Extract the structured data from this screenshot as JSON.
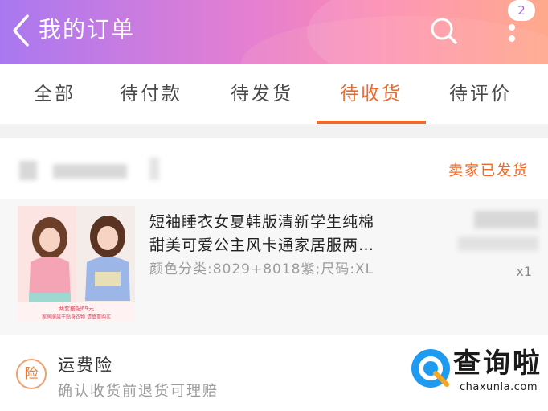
{
  "header": {
    "title": "我的订单",
    "badge_count": "2",
    "icons": [
      "back-chevron-icon",
      "search-icon",
      "more-vertical-icon"
    ]
  },
  "tabs": [
    {
      "label": "全部",
      "active": false
    },
    {
      "label": "待付款",
      "active": false
    },
    {
      "label": "待发货",
      "active": false
    },
    {
      "label": "待收货",
      "active": true
    },
    {
      "label": "待评价",
      "active": false
    }
  ],
  "order": {
    "status": "卖家已发货",
    "item": {
      "title_line1": "短袖睡衣女夏韩版清新学生纯棉",
      "title_line2": "甜美可爱公主风卡通家居服两…",
      "spec": "颜色分类:8029+8018紫;尺码:XL",
      "quantity": "x1",
      "thumb_caption_1": "两套搭配69元",
      "thumb_caption_2": "家居服属于贴身衣物  请慎重购买"
    }
  },
  "insurance": {
    "icon_char": "险",
    "title": "运费险",
    "description": "确认收货前退货可理赔"
  },
  "watermark": {
    "text": "查询啦",
    "url": "chaxunla.com"
  },
  "colors": {
    "accent": "#ef6a2a",
    "header_gradient": [
      "#a978f0",
      "#e47fd2",
      "#fd8bb0",
      "#ffa07f"
    ]
  }
}
